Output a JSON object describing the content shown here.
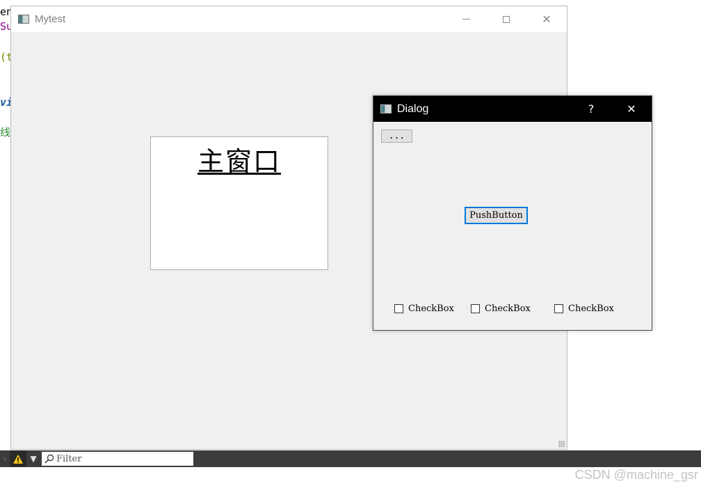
{
  "background_code": {
    "fragments": [
      {
        "text": "en",
        "color": "#000000"
      },
      {
        "text": "Sul",
        "color": "#8b008b"
      },
      {
        "text": "(tl",
        "color": "#808000"
      },
      {
        "text": "vi",
        "color": "#1f5fa0"
      },
      {
        "text": "线衫",
        "color": "#2e8b2e"
      }
    ]
  },
  "main_window": {
    "title": "Mytest",
    "icon": "app-window-icon",
    "center_label": "主窗口",
    "controls": {
      "minimize": "minimize-icon",
      "maximize": "maximize-icon",
      "close": "close-icon"
    },
    "close_glyph": "✕"
  },
  "dialog": {
    "title": "Dialog",
    "help_glyph": "?",
    "close_glyph": "✕",
    "tool_button_label": "...",
    "push_button_label": "PushButton",
    "checkboxes": [
      {
        "label": "CheckBox",
        "checked": false
      },
      {
        "label": "CheckBox",
        "checked": false
      },
      {
        "label": "CheckBox",
        "checked": false
      }
    ]
  },
  "bottom_bar": {
    "filter_placeholder": "Filter",
    "icons": [
      "expand-arrow-icon",
      "warning-icon",
      "filter-icon",
      "search-icon"
    ],
    "arrow_glyph": "›",
    "filter_glyph": "▼"
  },
  "watermark": "CSDN @machine_gsr",
  "colors": {
    "dialog_titlebar": "#000000",
    "focus_border": "#0078d7",
    "window_bg": "#f0f0f0"
  }
}
